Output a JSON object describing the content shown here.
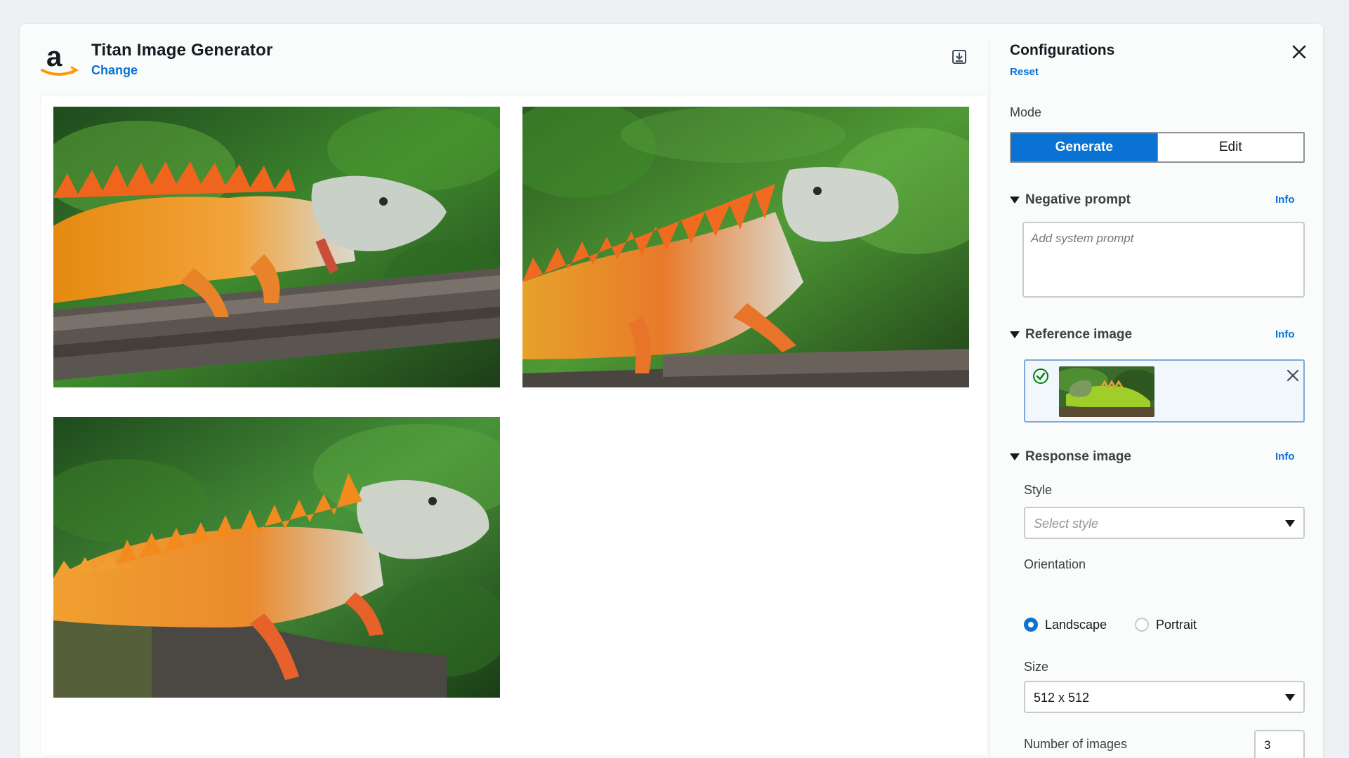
{
  "header": {
    "model_title": "Titan Image Generator",
    "change_label": "Change",
    "logo_letter": "a",
    "save_icon": "save-to-disk-icon"
  },
  "images": [
    {
      "alt": "generated-image-1"
    },
    {
      "alt": "generated-image-2"
    },
    {
      "alt": "generated-image-3"
    }
  ],
  "config": {
    "title": "Configurations",
    "reset_label": "Reset",
    "close_icon": "close-icon",
    "mode_label": "Mode",
    "mode_options": [
      "Generate",
      "Edit"
    ],
    "mode_selected": "Generate",
    "negative_prompt": {
      "title": "Negative prompt",
      "info": "Info",
      "placeholder": "Add system prompt",
      "value": ""
    },
    "reference_image": {
      "title": "Reference image",
      "info": "Info"
    },
    "response_image": {
      "title": "Response image",
      "info": "Info",
      "style_label": "Style",
      "style_placeholder": "Select style",
      "orientation_label": "Orientation",
      "orientation_options": [
        "Landscape",
        "Portrait"
      ],
      "orientation_selected": "Landscape",
      "size_label": "Size",
      "size_value": "512 x 512",
      "num_images_label": "Number of images",
      "num_images_value": "3",
      "num_images_slider_fraction": 0.6
    }
  },
  "colors": {
    "accent": "#0972d3",
    "amazon_orange": "#ff9900"
  }
}
